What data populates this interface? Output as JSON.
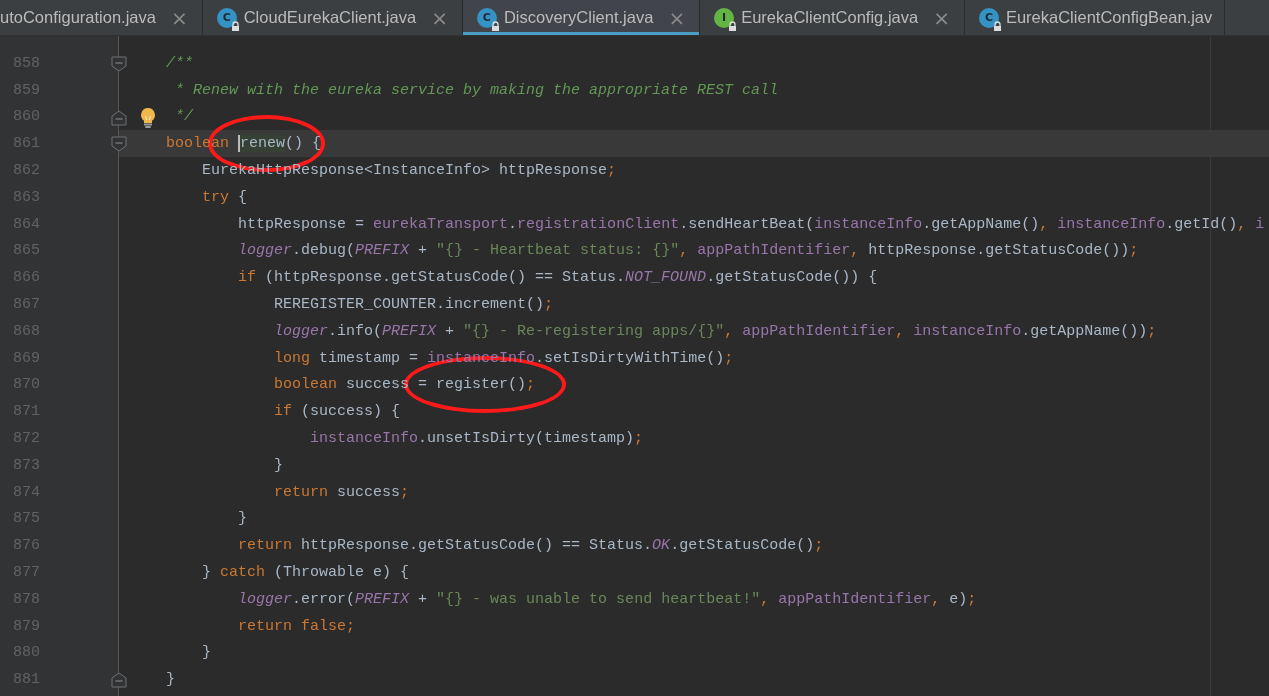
{
  "tabs": [
    {
      "label": "utoConfiguration.java",
      "selected": false,
      "close": "×"
    },
    {
      "label": "CloudEurekaClient.java",
      "selected": false,
      "kind": "class",
      "icon_letter": "C",
      "close": "×"
    },
    {
      "label": "DiscoveryClient.java",
      "selected": true,
      "kind": "class",
      "icon_letter": "C",
      "close": "×"
    },
    {
      "label": "EurekaClientConfig.java",
      "selected": false,
      "kind": "interface",
      "icon_letter": "I",
      "close": "×"
    },
    {
      "label": "EurekaClientConfigBean.jav",
      "selected": false,
      "kind": "class",
      "icon_letter": "C"
    }
  ],
  "editor": {
    "lines": [
      {
        "number": "858",
        "fold_start": true,
        "tokens": [
          {
            "kind": "comment",
            "text": "    /**"
          }
        ]
      },
      {
        "number": "859",
        "tokens": [
          {
            "kind": "comment",
            "text": "     * Renew with the eureka service by making the appropriate REST call"
          }
        ]
      },
      {
        "number": "860",
        "fold_end": true,
        "bulb": true,
        "tokens": [
          {
            "kind": "comment",
            "text": "     */"
          }
        ]
      },
      {
        "number": "861",
        "current": true,
        "fold_start": true,
        "tokens": [
          {
            "kind": "keyword",
            "text": "    boolean "
          },
          {
            "kind": "usage",
            "text": "renew",
            "circled": true
          },
          {
            "kind": "plain",
            "text": "() {"
          }
        ]
      },
      {
        "number": "862",
        "tokens": [
          {
            "kind": "plain",
            "text": "        EurekaHttpResponse<InstanceInfo> httpResponse"
          },
          {
            "kind": "punct",
            "text": ";"
          }
        ]
      },
      {
        "number": "863",
        "tokens": [
          {
            "kind": "keyword",
            "text": "        try"
          },
          {
            "kind": "plain",
            "text": " {"
          }
        ]
      },
      {
        "number": "864",
        "tokens": [
          {
            "kind": "plain",
            "text": "            httpResponse = "
          },
          {
            "kind": "field",
            "text": "eurekaTransport"
          },
          {
            "kind": "plain",
            "text": "."
          },
          {
            "kind": "field",
            "text": "registrationClient"
          },
          {
            "kind": "plain",
            "text": ".sendHeartBeat("
          },
          {
            "kind": "field",
            "text": "instanceInfo"
          },
          {
            "kind": "plain",
            "text": ".getAppName()"
          },
          {
            "kind": "punct",
            "text": ", "
          },
          {
            "kind": "field",
            "text": "instanceInfo"
          },
          {
            "kind": "plain",
            "text": ".getId()"
          },
          {
            "kind": "punct",
            "text": ", "
          },
          {
            "kind": "field",
            "text": "i"
          }
        ]
      },
      {
        "number": "865",
        "tokens": [
          {
            "kind": "static",
            "text": "            logger"
          },
          {
            "kind": "plain",
            "text": ".debug("
          },
          {
            "kind": "static",
            "text": "PREFIX"
          },
          {
            "kind": "plain",
            "text": " + "
          },
          {
            "kind": "string",
            "text": "\"{} - Heartbeat status: {}\""
          },
          {
            "kind": "punct",
            "text": ", "
          },
          {
            "kind": "field",
            "text": "appPathIdentifier"
          },
          {
            "kind": "punct",
            "text": ", "
          },
          {
            "kind": "plain",
            "text": "httpResponse.getStatusCode())"
          },
          {
            "kind": "punct",
            "text": ";"
          }
        ]
      },
      {
        "number": "866",
        "tokens": [
          {
            "kind": "keyword",
            "text": "            if"
          },
          {
            "kind": "plain",
            "text": " (httpResponse.getStatusCode() == Status."
          },
          {
            "kind": "static",
            "text": "NOT_FOUND"
          },
          {
            "kind": "plain",
            "text": ".getStatusCode()) {"
          }
        ]
      },
      {
        "number": "867",
        "tokens": [
          {
            "kind": "plain",
            "text": "                REREGISTER_COUNTER.increment()"
          },
          {
            "kind": "punct",
            "text": ";"
          }
        ]
      },
      {
        "number": "868",
        "tokens": [
          {
            "kind": "static",
            "text": "                logger"
          },
          {
            "kind": "plain",
            "text": ".info("
          },
          {
            "kind": "static",
            "text": "PREFIX"
          },
          {
            "kind": "plain",
            "text": " + "
          },
          {
            "kind": "string",
            "text": "\"{} - Re-registering apps/{}\""
          },
          {
            "kind": "punct",
            "text": ", "
          },
          {
            "kind": "field",
            "text": "appPathIdentifier"
          },
          {
            "kind": "punct",
            "text": ", "
          },
          {
            "kind": "field",
            "text": "instanceInfo"
          },
          {
            "kind": "plain",
            "text": ".getAppName())"
          },
          {
            "kind": "punct",
            "text": ";"
          }
        ]
      },
      {
        "number": "869",
        "tokens": [
          {
            "kind": "keyword",
            "text": "                long"
          },
          {
            "kind": "plain",
            "text": " timestamp = "
          },
          {
            "kind": "field",
            "text": "instanceInfo"
          },
          {
            "kind": "plain",
            "text": ".setIsDirtyWithTime()"
          },
          {
            "kind": "punct",
            "text": ";"
          }
        ]
      },
      {
        "number": "870",
        "tokens": [
          {
            "kind": "keyword",
            "text": "                boolean"
          },
          {
            "kind": "plain",
            "text": " success = "
          },
          {
            "kind": "plain",
            "text": "register()",
            "circled": true
          },
          {
            "kind": "punct",
            "text": ";"
          }
        ]
      },
      {
        "number": "871",
        "tokens": [
          {
            "kind": "keyword",
            "text": "                if"
          },
          {
            "kind": "plain",
            "text": " (success) {"
          }
        ]
      },
      {
        "number": "872",
        "tokens": [
          {
            "kind": "field",
            "text": "                    instanceInfo"
          },
          {
            "kind": "plain",
            "text": ".unsetIsDirty(timestamp)"
          },
          {
            "kind": "punct",
            "text": ";"
          }
        ]
      },
      {
        "number": "873",
        "tokens": [
          {
            "kind": "plain",
            "text": "                }"
          }
        ]
      },
      {
        "number": "874",
        "tokens": [
          {
            "kind": "keyword",
            "text": "                return"
          },
          {
            "kind": "plain",
            "text": " success"
          },
          {
            "kind": "punct",
            "text": ";"
          }
        ]
      },
      {
        "number": "875",
        "tokens": [
          {
            "kind": "plain",
            "text": "            }"
          }
        ]
      },
      {
        "number": "876",
        "tokens": [
          {
            "kind": "keyword",
            "text": "            return"
          },
          {
            "kind": "plain",
            "text": " httpResponse.getStatusCode() == Status."
          },
          {
            "kind": "static",
            "text": "OK"
          },
          {
            "kind": "plain",
            "text": ".getStatusCode()"
          },
          {
            "kind": "punct",
            "text": ";"
          }
        ]
      },
      {
        "number": "877",
        "tokens": [
          {
            "kind": "plain",
            "text": "        } "
          },
          {
            "kind": "keyword",
            "text": "catch"
          },
          {
            "kind": "plain",
            "text": " (Throwable e) {"
          }
        ]
      },
      {
        "number": "878",
        "tokens": [
          {
            "kind": "static",
            "text": "            logger"
          },
          {
            "kind": "plain",
            "text": ".error("
          },
          {
            "kind": "static",
            "text": "PREFIX"
          },
          {
            "kind": "plain",
            "text": " + "
          },
          {
            "kind": "string",
            "text": "\"{} - was unable to send heartbeat!\""
          },
          {
            "kind": "punct",
            "text": ", "
          },
          {
            "kind": "field",
            "text": "appPathIdentifier"
          },
          {
            "kind": "punct",
            "text": ", "
          },
          {
            "kind": "plain",
            "text": "e)"
          },
          {
            "kind": "punct",
            "text": ";"
          }
        ]
      },
      {
        "number": "879",
        "tokens": [
          {
            "kind": "keyword",
            "text": "            return false"
          },
          {
            "kind": "punct",
            "text": ";"
          }
        ]
      },
      {
        "number": "880",
        "tokens": [
          {
            "kind": "plain",
            "text": "        }"
          }
        ]
      },
      {
        "number": "881",
        "fold_end": true,
        "tokens": [
          {
            "kind": "plain",
            "text": "    }"
          }
        ]
      }
    ]
  }
}
